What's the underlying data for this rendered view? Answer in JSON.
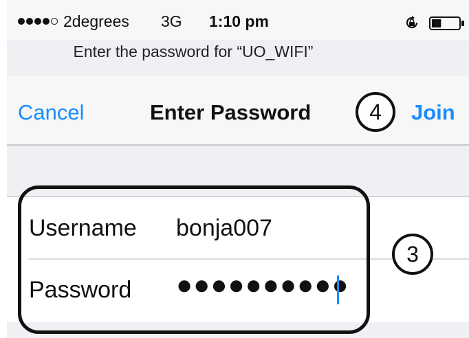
{
  "status_bar": {
    "signal_filled": 4,
    "signal_total": 5,
    "carrier": "2degrees",
    "network": "3G",
    "time": "1:10 pm",
    "icons": [
      "orientation-lock-icon",
      "battery-icon"
    ],
    "battery_level": 0.35
  },
  "prompt": "Enter the password for “UO_WIFI”",
  "nav": {
    "cancel_label": "Cancel",
    "title": "Enter Password",
    "join_label": "Join"
  },
  "form": {
    "username_label": "Username",
    "username_value": "bonja007",
    "password_label": "Password",
    "password_masked": "●●●●●●●●●●"
  },
  "annotations": {
    "step_join": "4",
    "step_credentials": "3"
  },
  "colors": {
    "accent": "#1a8cff",
    "background": "#efeff4",
    "bar": "#f7f7f7"
  }
}
